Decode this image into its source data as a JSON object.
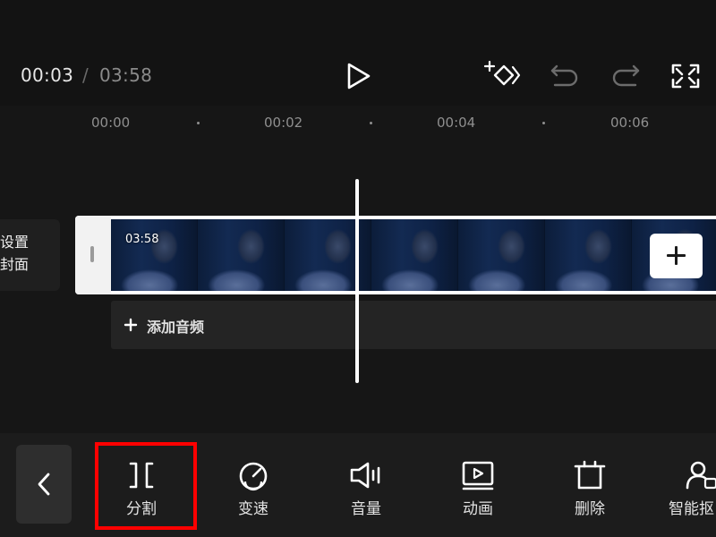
{
  "player": {
    "current_time": "00:03",
    "separator": "/",
    "total_time": "03:58",
    "icons": [
      "play-icon",
      "keyframe-add-icon",
      "undo-icon",
      "redo-icon",
      "fullscreen-icon"
    ]
  },
  "timeline": {
    "ruler_labels": [
      "00:00",
      "00:02",
      "00:04",
      "00:06"
    ],
    "cover": {
      "line1": "设置",
      "line2": "封面"
    },
    "clip": {
      "duration": "03:58",
      "frame_count": 7
    },
    "add_clip_icon": "plus-icon",
    "audio": {
      "label": "添加音频",
      "icon": "plus-icon"
    }
  },
  "toolbar": {
    "back_icon": "chevron-left-icon",
    "tools": [
      {
        "label": "分割",
        "icon": "split-icon",
        "highlighted": true
      },
      {
        "label": "变速",
        "icon": "speed-icon"
      },
      {
        "label": "音量",
        "icon": "volume-icon"
      },
      {
        "label": "动画",
        "icon": "animation-icon"
      },
      {
        "label": "删除",
        "icon": "delete-icon"
      },
      {
        "label": "智能抠",
        "icon": "smart-cutout-icon"
      }
    ]
  },
  "colors": {
    "background": "#141414",
    "toolbar_bg": "#1c1c1c",
    "highlight": "#ff0000",
    "text": "#e3e3e3",
    "muted": "#8a8a8a"
  }
}
